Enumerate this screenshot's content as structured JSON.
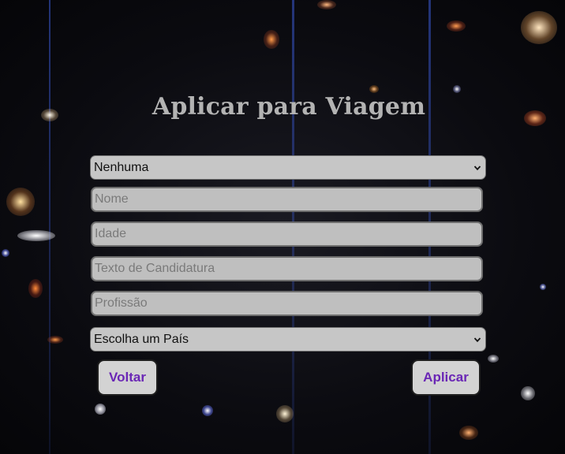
{
  "page": {
    "title": "Aplicar para Viagem"
  },
  "form": {
    "destination_select": {
      "selected": "Nenhuma"
    },
    "name_input": {
      "placeholder": "Nome"
    },
    "age_input": {
      "placeholder": "Idade"
    },
    "application_text_input": {
      "placeholder": "Texto de Candidatura"
    },
    "profession_input": {
      "placeholder": "Profissão"
    },
    "country_select": {
      "selected": "Escolha um País"
    }
  },
  "actions": {
    "back_label": "Voltar",
    "apply_label": "Aplicar"
  },
  "colors": {
    "button_text": "#6a26b5",
    "field_bg": "#bfbfbf",
    "title": "#b3b3b3"
  },
  "icons": {
    "select_arrow": "chevron-down-icon"
  }
}
